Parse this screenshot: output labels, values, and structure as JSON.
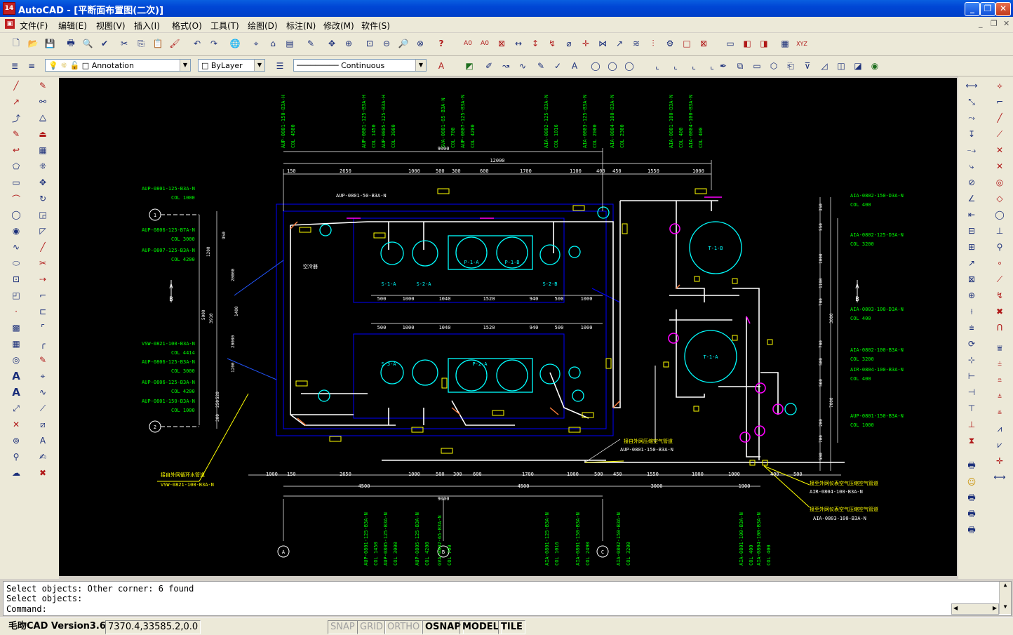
{
  "window": {
    "app_icon": "14",
    "title": "AutoCAD  - [平断面布置图(二次)]",
    "minimize": "_",
    "maximize": "❐",
    "close": "✕"
  },
  "menu": {
    "items": [
      "文件(F)",
      "编辑(E)",
      "视图(V)",
      "插入(I)",
      "格式(O)",
      "工具(T)",
      "绘图(D)",
      "标注(N)",
      "修改(M)",
      "软件(S)"
    ],
    "mdi_controls": [
      "_",
      "❐",
      "✕"
    ]
  },
  "properties": {
    "layer": "Annotation",
    "color": "ByLayer",
    "linetype": "Continuous"
  },
  "drawing": {
    "top_labels": [
      [
        "AUP-0801-150-B3A-H",
        "COL 4500"
      ],
      [
        "AUP-0801-125-B3A-H",
        "COL 1450"
      ],
      [
        "AUP-0805-125-B3A-H",
        "COL 3000"
      ],
      [
        "GVA-0801-65-B3A-N",
        "COL 700"
      ],
      [
        "AUP-0807-125-B3A-N",
        "COL 4200"
      ],
      [
        "AIA-0802-125-B3A-N",
        "COL 1016"
      ],
      [
        "AIA-0803-125-B3A-N",
        "COL 2000"
      ],
      [
        "AIA-0804-100-B3A-N",
        "COL 2300"
      ],
      [
        "AIA-0801-100-D3A-N",
        "COL 400"
      ],
      [
        "AIA-0804-100-B3A-N",
        "COL 400"
      ]
    ],
    "left_labels": [
      [
        "AUP-0801-125-B3A-N",
        "COL 1000"
      ],
      [
        "AUP-0806-125-B7A-N",
        "COL 3000"
      ],
      [
        "AUP-0807-125-B3A-N",
        "COL 4200"
      ],
      [
        "VSW-0821-100-B3A-N",
        "COL 4414"
      ],
      [
        "AUP-0806-125-B3A-N",
        "COL 3000"
      ],
      [
        "AUP-0806-125-B3A-N",
        "COL 4200"
      ],
      [
        "AUP-0801-150-B3A-N",
        "COL 1000"
      ]
    ],
    "right_labels": [
      [
        "AIA-0802-150-D3A-N",
        "COL 400"
      ],
      [
        "AIA-0802-125-D3A-N",
        "COL 3200"
      ],
      [
        "AIA-0803-100-D3A-N",
        "COL 400"
      ],
      [
        "AIA-0802-100-B3A-N",
        "COL 3200"
      ],
      [
        "AIR-0804-100-B3A-N",
        "COL 400"
      ],
      [
        "AUP-0801-150-B3A-N",
        "COL 1000"
      ]
    ],
    "bottom_labels": [
      [
        "AUP-0801-125-B3A-N",
        "COL 1450"
      ],
      [
        "AUP-0805-125-B3A-N",
        "COL 3000"
      ],
      [
        "AUP-0805-125-B3A-N",
        "COL 4200"
      ],
      [
        "GVA-0802-65-B3A-N",
        "COL 700"
      ],
      [
        "AIA-0801-125-B3A-N",
        "COL 1016"
      ],
      [
        "AIA-0801-150-B3A-N",
        "COL 2490"
      ],
      [
        "AIA-0802-150-B3A-N",
        "COL 3200"
      ],
      [
        "AIA-0801-100-B3A-N",
        "COL 400"
      ],
      [
        "AIA-0804-100-B3A-N",
        "COL 400"
      ]
    ],
    "top_dims": [
      "150",
      "2650",
      "1000",
      "500",
      "300",
      "600",
      "1700",
      "1100",
      "400",
      "450",
      "1550",
      "1000"
    ],
    "top_total_1": "9000",
    "top_total_2": "12000",
    "bottom_dims": [
      "1000",
      "150",
      "2650",
      "1000",
      "500",
      "300",
      "600",
      "1700",
      "1000",
      "500",
      "450",
      "1550",
      "1000",
      "1000",
      "400",
      "500"
    ],
    "bottom_sub": [
      "4500",
      "4500",
      "3000",
      "1900"
    ],
    "bottom_total": "9000",
    "row_dims_1": [
      "500",
      "1000",
      "1040",
      "1520",
      "940",
      "500",
      "1000"
    ],
    "row_dims_2": [
      "500",
      "1000",
      "1040",
      "1520",
      "940",
      "500",
      "1000"
    ],
    "left_dims": [
      "5000",
      "3910",
      "950",
      "1200",
      "20000",
      "1400",
      "20000",
      "1200",
      "520",
      "250",
      "300"
    ],
    "right_dims": [
      "350",
      "550",
      "1000",
      "1100",
      "700",
      "3000",
      "700",
      "500",
      "560",
      "7000",
      "200",
      "700",
      "500"
    ],
    "axis_rows": [
      "1",
      "2"
    ],
    "axis_cols": [
      "A",
      "B",
      "C"
    ],
    "section_left": [
      "A",
      "B"
    ],
    "section_right": [
      "A",
      "B"
    ],
    "equipment": [
      "S-1-A",
      "S-2-A",
      "P-1-A",
      "P-1-B",
      "S-2-B",
      "S-3-A",
      "T-1-B",
      "T-1-A",
      "P-2-A"
    ],
    "note_left": [
      "接自外网循环水管道",
      "VSW-0821-100-B3A-N"
    ],
    "note_mid": [
      "接自外网压缩空气管道",
      "AUP-0801-150-B3A-N"
    ],
    "note_right_1": [
      "接至外网仪表空气压缩空气管道",
      "AIR-0804-100-B3A-N"
    ],
    "note_right_2": [
      "接至外网仪表空气压缩空气管道",
      "AIA-0803-100-B3A-N"
    ],
    "note_equip": "空冷器",
    "small_label": "AUP-0801-50-B3A-N"
  },
  "command": {
    "history": [
      "Select objects: Other corner: 6 found",
      "Select objects:"
    ],
    "prompt": "Command:"
  },
  "status": {
    "version": "毛昒CAD Version3.6",
    "coords": "7370.4,33585.2,0.0",
    "snap": "SNAP",
    "grid": "GRID",
    "ortho": "ORTHO",
    "osnap": "OSNAP",
    "model": "MODEL",
    "tile": "TILE"
  },
  "colors": {
    "canvas": "#000000",
    "pipe": "#ffffff",
    "dim": "#ffffff",
    "label": "#00ff00",
    "equipment": "#00ffff",
    "frame": "#0000ff",
    "tag": "#ffff00",
    "accent": "#ff00ff"
  }
}
